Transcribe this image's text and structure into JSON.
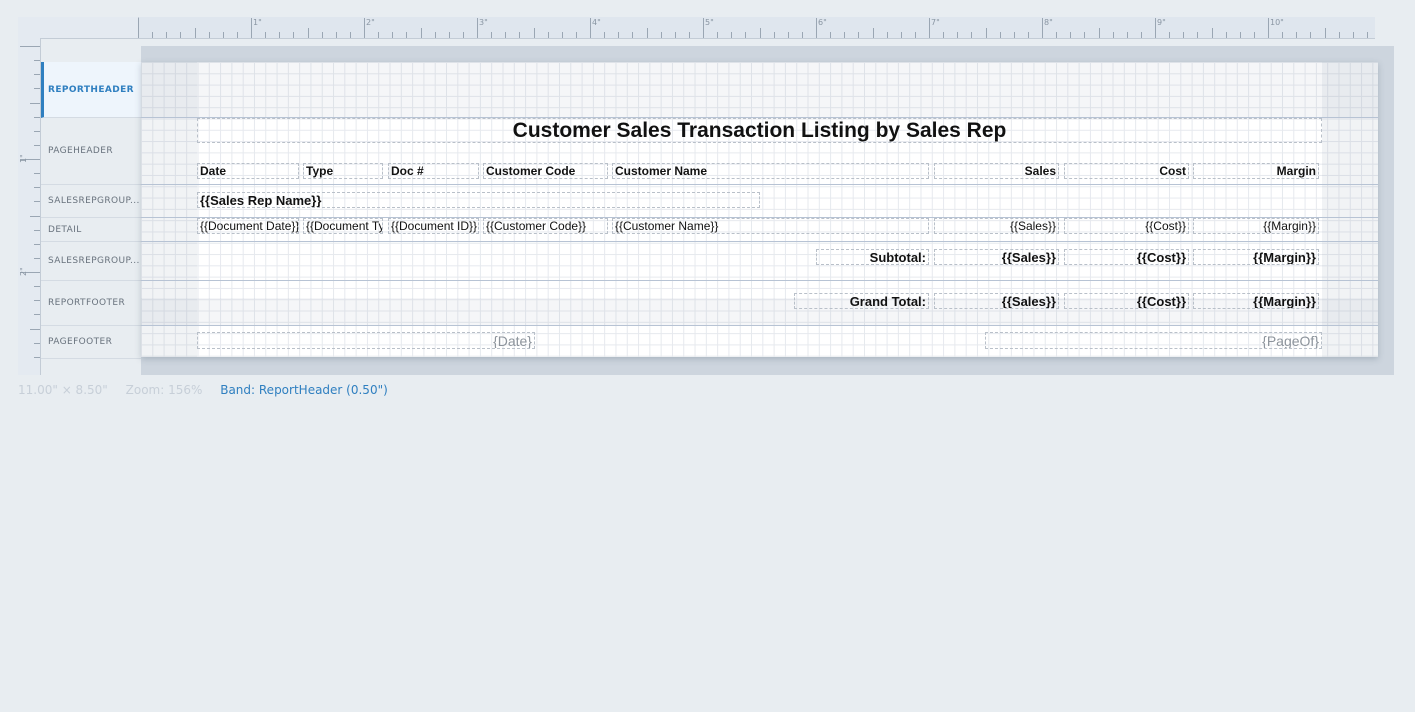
{
  "ruler": {
    "inches": [
      "1\"",
      "2\"",
      "3\"",
      "4\"",
      "5\"",
      "6\"",
      "7\"",
      "8\"",
      "9\"",
      "10\""
    ],
    "vertical": [
      "1\"",
      "2\""
    ]
  },
  "bands": [
    {
      "label": "REPORTHEADER",
      "active": true
    },
    {
      "label": "PAGEHEADER",
      "active": false
    },
    {
      "label": "SALESREPGROUP...",
      "active": false
    },
    {
      "label": "DETAIL",
      "active": false
    },
    {
      "label": "SALESREPGROUP...",
      "active": false
    },
    {
      "label": "REPORTFOOTER",
      "active": false
    },
    {
      "label": "PAGEFOOTER",
      "active": false
    }
  ],
  "report": {
    "title": "Customer Sales Transaction Listing by Sales Rep",
    "columns": {
      "date": "Date",
      "type": "Type",
      "doc": "Doc #",
      "customer_code": "Customer Code",
      "customer_name": "Customer Name",
      "sales": "Sales",
      "cost": "Cost",
      "margin": "Margin"
    },
    "group_header": "{{Sales Rep Name}}",
    "detail": {
      "date": "{{Document Date}}",
      "type": "{{Document Type}}",
      "doc": "{{Document ID}}",
      "customer_code": "{{Customer Code}}",
      "customer_name": "{{Customer Name}}",
      "sales": "{{Sales}}",
      "cost": "{{Cost}}",
      "margin": "{{Margin}}"
    },
    "subtotal": {
      "label": "Subtotal:",
      "sales": "{{Sales}}",
      "cost": "{{Cost}}",
      "margin": "{{Margin}}"
    },
    "grand_total": {
      "label": "Grand Total:",
      "sales": "{{Sales}}",
      "cost": "{{Cost}}",
      "margin": "{{Margin}}"
    },
    "page_footer": {
      "date": "{Date}",
      "page": "{PageOf}"
    }
  },
  "status": {
    "size": "11.00\" × 8.50\"",
    "zoom": "Zoom: 156%",
    "band": "Band: ReportHeader (0.50\")"
  }
}
